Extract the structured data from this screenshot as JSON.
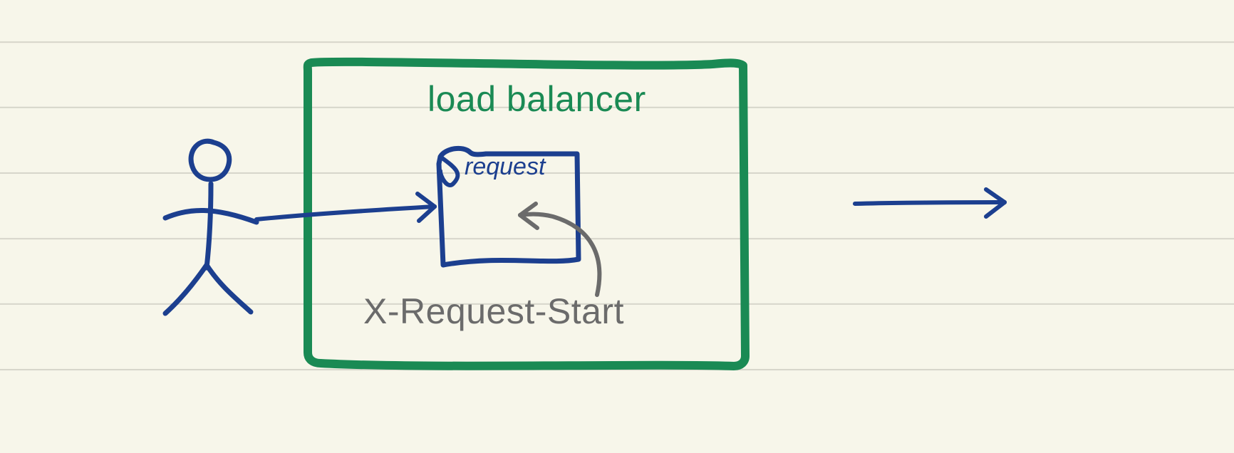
{
  "diagram": {
    "title": "load balancer",
    "request_label": "request",
    "header_name": "X-Request-Start",
    "colors": {
      "paper_bg": "#f7f6ea",
      "rule_line": "#d7d6cb",
      "green": "#1a8a54",
      "blue": "#1c3f8f",
      "grey": "#6b6b6b"
    },
    "actors": {
      "user": "stick-figure client",
      "load_balancer_box": "load balancer container",
      "request_doc": "request sheet inside load balancer",
      "arrow_in": "client → load balancer",
      "arrow_added_header": "X-Request-Start header added to request",
      "arrow_out": "load balancer → upstream"
    }
  }
}
